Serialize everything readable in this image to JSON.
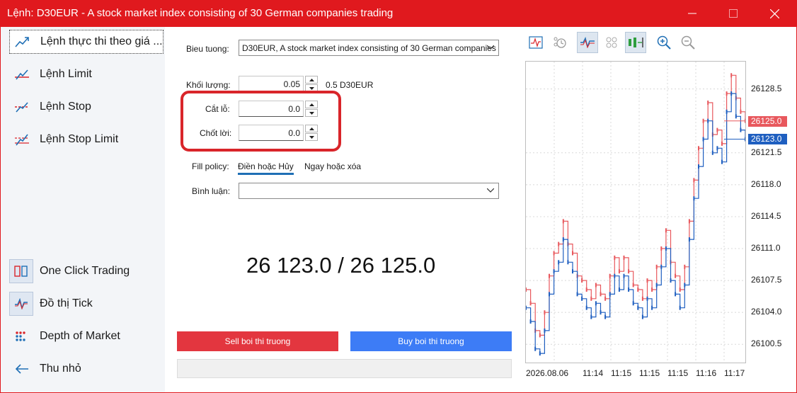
{
  "window": {
    "title": "Lệnh: D30EUR - A stock market index consisting of 30 German companies trading"
  },
  "sidebar": {
    "top_items": [
      {
        "label": "Lệnh thực thi theo giá ...",
        "icon": "market-execution-icon"
      },
      {
        "label": "Lệnh Limit",
        "icon": "limit-order-icon"
      },
      {
        "label": "Lệnh Stop",
        "icon": "stop-order-icon"
      },
      {
        "label": "Lệnh Stop Limit",
        "icon": "stop-limit-order-icon"
      }
    ],
    "bottom_items": [
      {
        "label": "One Click Trading",
        "icon": "one-click-trading-icon"
      },
      {
        "label": "Đồ thị Tick",
        "icon": "tick-chart-icon"
      },
      {
        "label": "Depth of Market",
        "icon": "depth-of-market-icon"
      },
      {
        "label": "Thu nhỏ",
        "icon": "arrow-left-icon"
      }
    ]
  },
  "form": {
    "symbol_label": "Bieu tuong:",
    "symbol_value": "D30EUR, A stock market index consisting of 30 German companies trading",
    "volume_label": "Khối lượng:",
    "volume_value": "0.05",
    "volume_note": "0.5 D30EUR",
    "stop_loss_label": "Cắt lỗ:",
    "stop_loss_value": "0.0",
    "take_profit_label": "Chốt lời:",
    "take_profit_value": "0.0",
    "fill_policy_label": "Fill policy:",
    "fill_options": [
      "Điền hoặc Hủy",
      "Ngay hoặc xóa"
    ],
    "fill_selected": "Điền hoặc Hủy",
    "comment_label": "Bình luận:",
    "comment_value": ""
  },
  "quote": {
    "text": "26 123.0 / 26 125.0"
  },
  "actions": {
    "sell_label": "Sell boi thi truong",
    "buy_label": "Buy boi thi truong"
  },
  "colors": {
    "titlebar": "#e0191e",
    "sell": "#e3363f",
    "buy": "#3d7cf6",
    "ask_line": "#e8585d",
    "bid_line": "#1f5fc0"
  },
  "chart_data": {
    "type": "line",
    "y_ticks": [
      "26128.5",
      "26121.5",
      "26118.0",
      "26114.5",
      "26111.0",
      "26107.5",
      "26104.0",
      "26100.5"
    ],
    "ask_tag": "26125.0",
    "bid_tag": "26123.0",
    "x_ticks": [
      "2026.08.06",
      "11:14",
      "11:15",
      "11:15",
      "11:15",
      "11:16",
      "11:17"
    ],
    "ylim": [
      26098.5,
      26131.5
    ],
    "grid": true,
    "series": [
      {
        "name": "Ask",
        "values": [
          26106.5,
          26105,
          26102,
          26101.5,
          26104,
          26108,
          26110.5,
          26111.5,
          26114,
          26111.5,
          26110.5,
          26108,
          26107.5,
          26106.5,
          26105.5,
          26107,
          26106,
          26105.5,
          26108,
          26110,
          26108.5,
          26110,
          26108.5,
          26107,
          26106.5,
          26105.5,
          26107.5,
          26106.5,
          26109,
          26111,
          26113,
          26109.5,
          26108,
          26106.5,
          26109,
          26114,
          26118.5,
          26122,
          26125,
          26127,
          26123.5,
          26124,
          26122.5,
          26128,
          26130,
          26127.5,
          26126,
          26125
        ]
      },
      {
        "name": "Bid",
        "values": [
          26104.5,
          26103,
          26100,
          26099.5,
          26102,
          26106,
          26108.5,
          26109.5,
          26112,
          26109.5,
          26108.5,
          26106,
          26105.5,
          26104.5,
          26103.5,
          26105,
          26104,
          26103.5,
          26106,
          26108,
          26106.5,
          26108,
          26106.5,
          26105,
          26104.5,
          26103.5,
          26105.5,
          26104.5,
          26107,
          26109,
          26111,
          26107.5,
          26106,
          26104.5,
          26107,
          26112,
          26116.5,
          26120,
          26123,
          26125,
          26121.5,
          26122,
          26120.5,
          26126,
          26128,
          26125.5,
          26124,
          26123
        ]
      }
    ]
  }
}
